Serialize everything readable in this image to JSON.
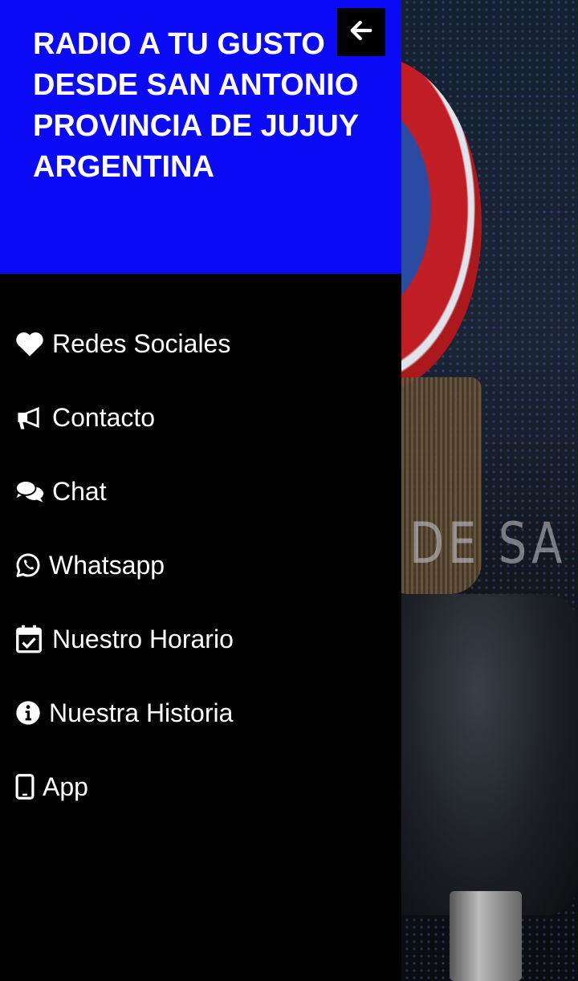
{
  "background": {
    "visible_text": "DE SA"
  },
  "drawer": {
    "header": {
      "title": "RADIO A TU GUSTO DESDE SAN ANTONIO PROVINCIA DE JUJUY ARGENTINA",
      "background_color": "#0a0af7",
      "back_icon": "arrow-left-icon"
    },
    "items": [
      {
        "label": "Redes Sociales",
        "icon": "heart-icon"
      },
      {
        "label": "Contacto",
        "icon": "megaphone-icon"
      },
      {
        "label": "Chat",
        "icon": "chat-bubbles-icon"
      },
      {
        "label": "Whatsapp",
        "icon": "whatsapp-icon"
      },
      {
        "label": "Nuestro Horario",
        "icon": "calendar-check-icon"
      },
      {
        "label": "Nuestra Historia",
        "icon": "info-circle-icon"
      },
      {
        "label": "App",
        "icon": "tablet-icon"
      }
    ]
  }
}
